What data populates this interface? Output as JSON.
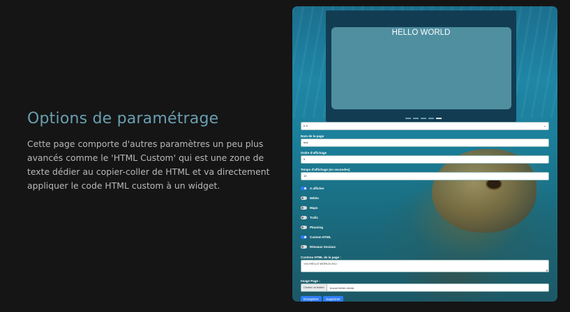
{
  "intro": {
    "title": "Options de paramétrage",
    "body": "Cette page comporte d'autres paramètres un peu plus avancés comme le 'HTML Custom' qui est une zone de texte dédier au copier-coller de HTML et va directement appliquer le code HTML custom à un widget."
  },
  "preview": {
    "title": "HELLO WORLD",
    "carousel_active_index": 4
  },
  "form": {
    "select_value": "fr-fr",
    "page_name_label": "Nom de la page",
    "page_name_value": "test",
    "display_order_label": "Ordre d'affichage",
    "display_order_value": "5",
    "display_time_label": "Temps d'affichage (en secondes)",
    "display_time_value": "10",
    "toggles": [
      {
        "label": "A afficher",
        "on": true
      },
      {
        "label": "Météo",
        "on": false
      },
      {
        "label": "Maps",
        "on": false
      },
      {
        "label": "Trafic",
        "on": false
      },
      {
        "label": "Planning",
        "on": false
      },
      {
        "label": "Custom HTML",
        "on": true
      },
      {
        "label": "Réseaux Sociaux",
        "on": false
      }
    ],
    "html_content_label": "Contenu HTML de la page :",
    "html_content_value": "<h1>HELLO WORLD</h1>",
    "image_label": "Image Page :",
    "file_button": "Choisir un fichier",
    "file_name": "Aucun fichier choisi",
    "save_button": "Enregistrer",
    "delete_button": "Supprimer"
  },
  "colors": {
    "background": "#151515",
    "heading": "#6a9fb1",
    "body_text": "#b9b9b9",
    "accent": "#2f7cf6"
  }
}
